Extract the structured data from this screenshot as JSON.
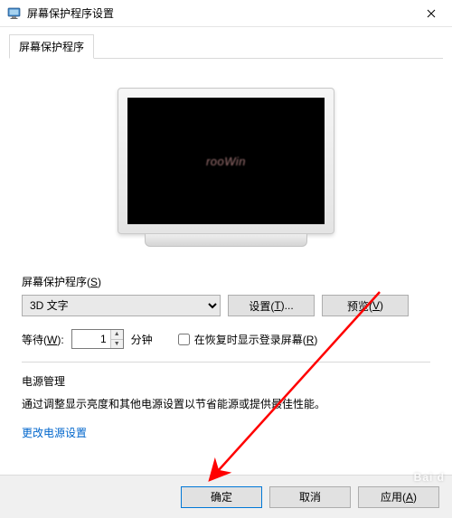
{
  "window": {
    "title": "屏幕保护程序设置"
  },
  "tab": {
    "label": "屏幕保护程序"
  },
  "screensaver": {
    "group_label_prefix": "屏幕保护程序(",
    "group_label_key": "S",
    "group_label_suffix": ")",
    "selected": "3D 文字",
    "settings_btn_prefix": "设置(",
    "settings_btn_key": "T",
    "settings_btn_suffix": ")...",
    "preview_btn_prefix": "预览(",
    "preview_btn_key": "V",
    "preview_btn_suffix": ")",
    "wait_label_prefix": "等待(",
    "wait_label_key": "W",
    "wait_label_suffix": "):",
    "wait_value": "1",
    "wait_unit": "分钟",
    "resume_label_prefix": "在恢复时显示登录屏幕(",
    "resume_label_key": "R",
    "resume_label_suffix": ")",
    "preview_text": "rooWin"
  },
  "power": {
    "heading": "电源管理",
    "desc": "通过调整显示亮度和其他电源设置以节省能源或提供最佳性能。",
    "link": "更改电源设置"
  },
  "buttons": {
    "ok": "确定",
    "cancel": "取消",
    "apply_prefix": "应用(",
    "apply_key": "A",
    "apply_suffix": ")"
  },
  "watermark": {
    "main": "Bai d",
    "sub": ""
  }
}
